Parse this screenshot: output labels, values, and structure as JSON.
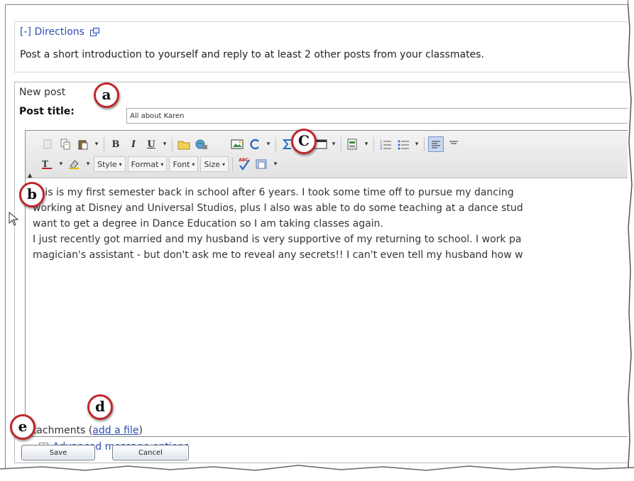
{
  "directions": {
    "toggle": "[-]",
    "title": "Directions",
    "text": "Post a short introduction to yourself and reply to at least 2 other posts from your classmates."
  },
  "post": {
    "heading": "New post",
    "title_label": "Post title:",
    "title_value": "All about Karen"
  },
  "toolbar": {
    "bold": "B",
    "italic": "I",
    "underline": "U",
    "style_label": "Style",
    "format_label": "Format",
    "font_label": "Font",
    "size_label": "Size",
    "spellcheck_label": "ABC"
  },
  "editor": {
    "lines": [
      "This is my first semester back in school after 6 years.  I took some time off to pursue my dancing",
      "working at Disney and Universal Studios, plus I also was able to do some teaching at a dance stud",
      "want to get a degree in Dance Education so I am taking classes again.",
      "I just recently got married and my husband is very supportive of my returning to school.  I work pa",
      "magician's assistant - but don't ask me to reveal any secrets!!  I can't even tell my husband how w"
    ]
  },
  "attachments": {
    "label": "Attachments",
    "open_paren": "(",
    "link": "add a file",
    "close_paren": ")"
  },
  "advanced": {
    "label": "Advanced message options"
  },
  "buttons": {
    "save": "Save",
    "cancel": "Cancel"
  },
  "callouts": {
    "a": "a",
    "b": "b",
    "c": "C",
    "d": "d",
    "e": "e"
  },
  "colors": {
    "link": "#2b4fb4",
    "callout_ring": "#c0262d"
  }
}
